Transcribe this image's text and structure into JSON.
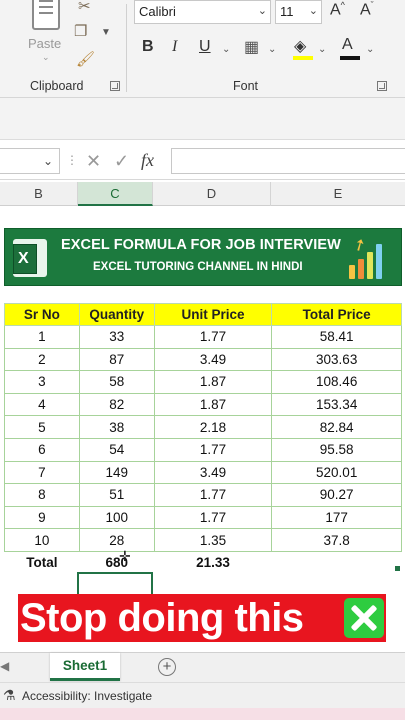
{
  "ribbon": {
    "clipboard": {
      "paste_label": "Paste",
      "group_label": "Clipboard"
    },
    "font": {
      "font_name": "Calibri",
      "font_size": "11",
      "group_label": "Font",
      "bold": "B",
      "italic": "I",
      "underline": "U",
      "grow": "A^",
      "shrink": "A˅",
      "font_color": "A"
    }
  },
  "formula_bar": {
    "fx": "fx",
    "cancel": "✕",
    "enter": "✓"
  },
  "columns": [
    "B",
    "C",
    "D",
    "E"
  ],
  "banner": {
    "title": "EXCEL FORMULA FOR JOB INTERVIEW",
    "subtitle": "EXCEL TUTORING CHANNEL IN HINDI",
    "logo_letter": "X"
  },
  "table": {
    "headers": [
      "Sr No",
      "Quantity",
      "Unit Price",
      "Total Price"
    ],
    "rows": [
      [
        "1",
        "33",
        "1.77",
        "58.41"
      ],
      [
        "2",
        "87",
        "3.49",
        "303.63"
      ],
      [
        "3",
        "58",
        "1.87",
        "108.46"
      ],
      [
        "4",
        "82",
        "1.87",
        "153.34"
      ],
      [
        "5",
        "38",
        "2.18",
        "82.84"
      ],
      [
        "6",
        "54",
        "1.77",
        "95.58"
      ],
      [
        "7",
        "149",
        "3.49",
        "520.01"
      ],
      [
        "8",
        "51",
        "1.77",
        "90.27"
      ],
      [
        "9",
        "100",
        "1.77",
        "177"
      ],
      [
        "10",
        "28",
        "1.35",
        "37.8"
      ]
    ],
    "total": [
      "Total",
      "680",
      "21.33",
      ""
    ]
  },
  "caption": {
    "text": "Stop doing this"
  },
  "sheet_tabs": {
    "active": "Sheet1",
    "add": "+"
  },
  "status": {
    "text": "Accessibility: Investigate"
  },
  "colors": {
    "excel_green": "#217346",
    "header_yellow": "#ffff00",
    "banner_green": "#1c7a3e",
    "caption_red": "#e8151f"
  }
}
